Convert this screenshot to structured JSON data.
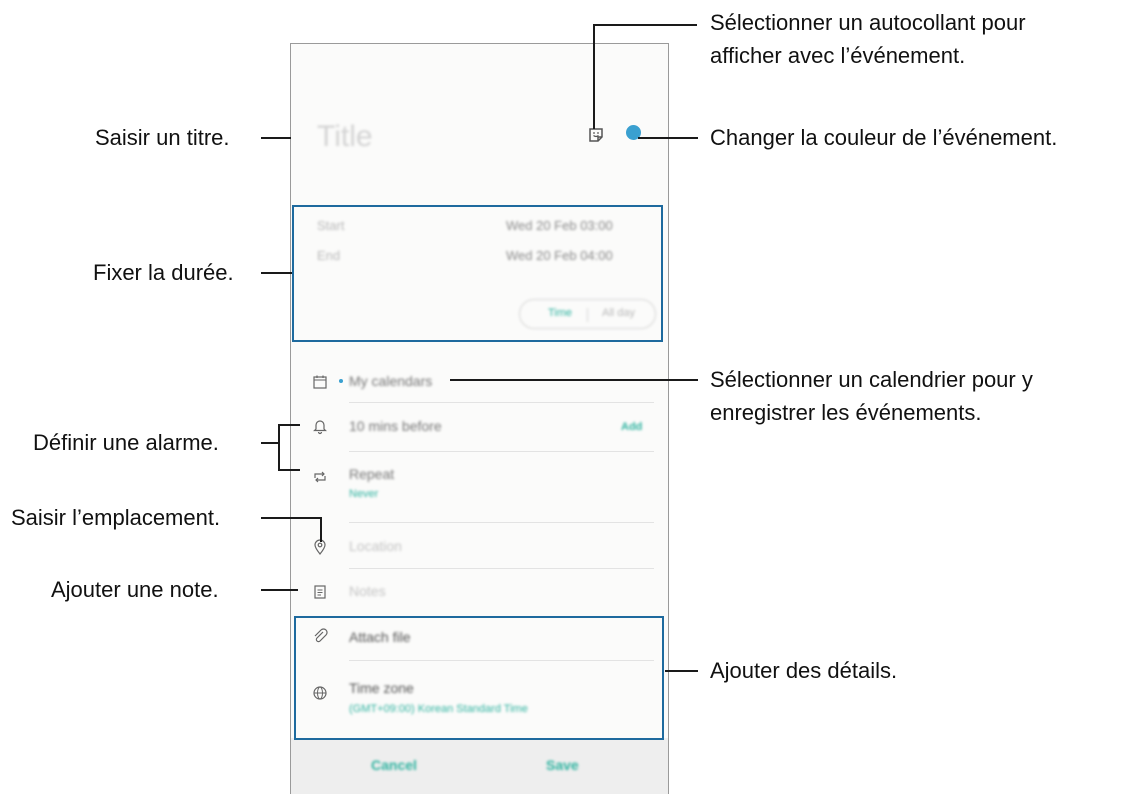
{
  "phone": {
    "title_placeholder": "Title",
    "color_accent": "#3aa0d0",
    "teal": "#2fb3a0",
    "date": {
      "start_label": "Start",
      "start_value": "Wed 20 Feb 03:00",
      "end_label": "End",
      "end_value": "Wed 20 Feb 04:00",
      "toggle_time": "Time",
      "toggle_allday": "All day"
    },
    "calendar": "My calendars",
    "alarm": "10 mins before",
    "alarm_action": "Add",
    "repeat": "Repeat",
    "repeat_value": "Never",
    "location": "Location",
    "notes": "Notes",
    "attach": "Attach file",
    "timezone": "Time zone",
    "timezone_value": "(GMT+09:00) Korean Standard Time",
    "cancel": "Cancel",
    "save": "Save"
  },
  "annotations": {
    "title": "Saisir un titre.",
    "duration": "Fixer la durée.",
    "alarm": "Définir une alarme.",
    "location": "Saisir l’emplacement.",
    "note": "Ajouter une note.",
    "sticker_line1": "Sélectionner un autocollant pour",
    "sticker_line2": "afficher avec l’événement.",
    "color": "Changer la couleur de l’événement.",
    "calendar_line1": "Sélectionner un calendrier pour y",
    "calendar_line2": "enregistrer les événements.",
    "details": "Ajouter des détails."
  }
}
